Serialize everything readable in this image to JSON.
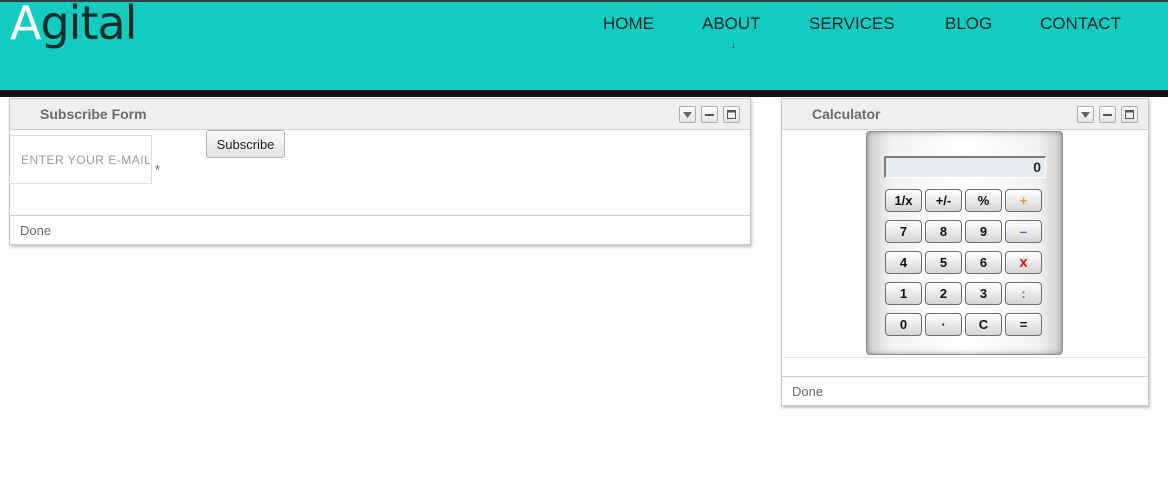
{
  "brand": {
    "logo_first": "A",
    "logo_rest": "gital"
  },
  "nav": {
    "items": [
      "HOME",
      "ABOUT",
      "SERVICES",
      "BLOG",
      "CONTACT"
    ],
    "caret": "↓"
  },
  "colors": {
    "header_bg": "#12ccc2",
    "header_border": "#111111",
    "logo_text": "#1b2b2a"
  },
  "subscribe_portlet": {
    "title": "Subscribe Form",
    "email_placeholder": "ENTER YOUR E-MAIL",
    "required_mark": "*",
    "button_label": "Subscribe",
    "status": "Done"
  },
  "calculator_portlet": {
    "title": "Calculator",
    "display": "0",
    "keys": [
      [
        "1/x",
        "+/-",
        "%",
        "+"
      ],
      [
        "7",
        "8",
        "9",
        "–"
      ],
      [
        "4",
        "5",
        "6",
        "x"
      ],
      [
        "1",
        "2",
        "3",
        ":"
      ],
      [
        "0",
        "·",
        "C",
        "="
      ]
    ],
    "status": "Done"
  },
  "icons": [
    "dropdown-icon",
    "minimize-icon",
    "maximize-icon"
  ]
}
